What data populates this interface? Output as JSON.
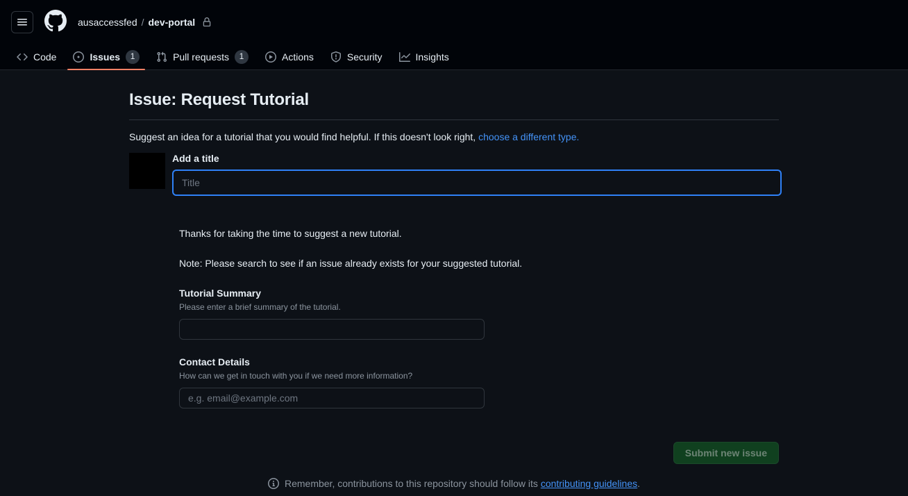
{
  "header": {
    "menu_icon": "hamburger-icon",
    "logo_icon": "github-logo-icon",
    "owner": "ausaccessfed",
    "separator": "/",
    "repo": "dev-portal",
    "visibility_icon": "lock-icon"
  },
  "repo_nav": {
    "items": [
      {
        "label": "Code",
        "icon": "code-icon",
        "count": null,
        "selected": false
      },
      {
        "label": "Issues",
        "icon": "issue-opened-icon",
        "count": "1",
        "selected": true
      },
      {
        "label": "Pull requests",
        "icon": "git-pull-request-icon",
        "count": "1",
        "selected": false
      },
      {
        "label": "Actions",
        "icon": "play-icon",
        "count": null,
        "selected": false
      },
      {
        "label": "Security",
        "icon": "shield-icon",
        "count": null,
        "selected": false
      },
      {
        "label": "Insights",
        "icon": "graph-icon",
        "count": null,
        "selected": false
      }
    ]
  },
  "form": {
    "page_title": "Issue: Request Tutorial",
    "subtitle_text": "Suggest an idea for a tutorial that you would find helpful. If this doesn't look right, ",
    "subtitle_link": "choose a different type.",
    "title_label": "Add a title",
    "title_value": "",
    "title_placeholder": "Title",
    "intro_paragraph": "Thanks for taking the time to suggest a new tutorial.",
    "note_paragraph": "Note: Please search to see if an issue already exists for your suggested tutorial.",
    "fields": [
      {
        "label": "Tutorial Summary",
        "description": "Please enter a brief summary of the tutorial.",
        "value": "",
        "placeholder": ""
      },
      {
        "label": "Contact Details",
        "description": "How can we get in touch with you if we need more information?",
        "value": "",
        "placeholder": "e.g. email@example.com"
      }
    ],
    "submit_label": "Submit new issue",
    "footer_icon": "info-icon",
    "footer_text": "Remember, contributions to this repository should follow its ",
    "footer_link": "contributing guidelines",
    "footer_text_end": "."
  },
  "colors": {
    "page_bg": "#0d1117",
    "header_bg": "#010409",
    "accent_link": "#4493f8",
    "tab_indicator": "#f78166",
    "focus_border": "#2f81f7",
    "submit_bg": "#10401f"
  }
}
